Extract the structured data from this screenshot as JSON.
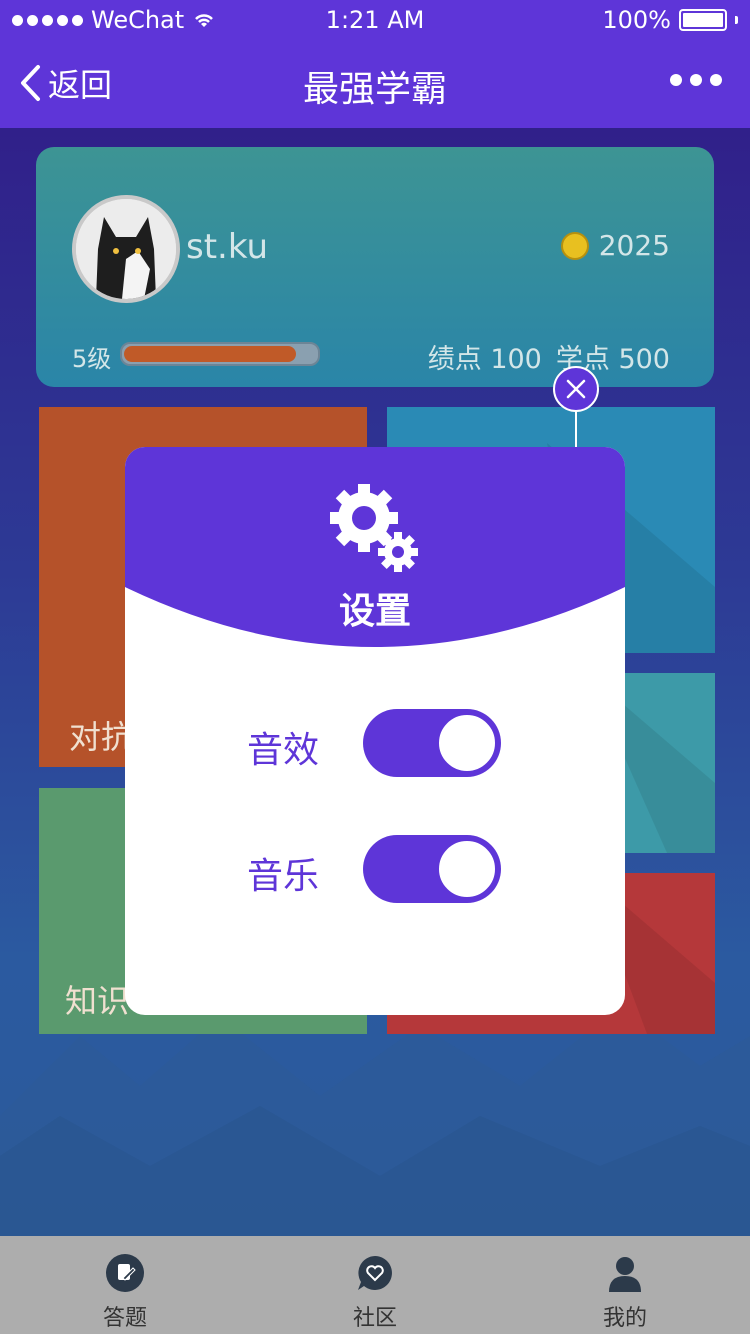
{
  "status_bar": {
    "carrier": "WeChat",
    "time": "1:21 AM",
    "battery": "100%"
  },
  "nav": {
    "back_label": "返回",
    "title": "最强学霸"
  },
  "profile": {
    "username": "st.ku",
    "coins": "2025",
    "level": "5级",
    "progress": 0.9,
    "gpa_label": "绩点",
    "gpa_value": "100",
    "credit_label": "学点",
    "credit_value": "500"
  },
  "tiles": {
    "orange_label": "对抗",
    "green_label": "知识"
  },
  "modal": {
    "title": "设置",
    "settings": [
      {
        "label": "音效",
        "enabled": true
      },
      {
        "label": "音乐",
        "enabled": true
      }
    ]
  },
  "tab_bar": {
    "items": [
      {
        "label": "答题",
        "icon": "quiz-icon"
      },
      {
        "label": "社区",
        "icon": "community-icon"
      },
      {
        "label": "我的",
        "icon": "profile-icon"
      }
    ]
  },
  "colors": {
    "brand": "#5e35d8",
    "orange": "#b5522a",
    "blue": "#2a8ab5",
    "teal": "#3d9aa8",
    "green": "#5a9a6e",
    "red": "#b5383a"
  }
}
